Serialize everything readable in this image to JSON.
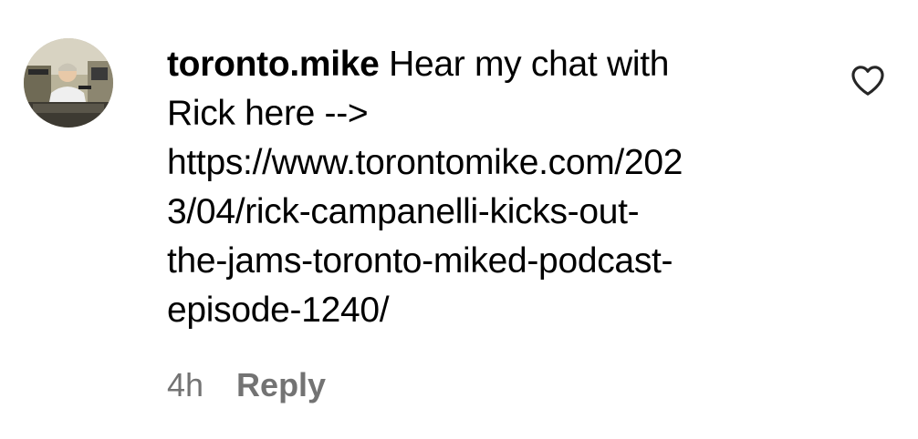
{
  "comment": {
    "username": "toronto.mike",
    "text_lines": [
      "Hear my chat with",
      "Rick here -->",
      "https://www.torontomike.com/202",
      "3/04/rick-campanelli-kicks-out-",
      "the-jams-toronto-miked-podcast-",
      "episode-1240/"
    ],
    "timestamp": "4h",
    "reply_label": "Reply",
    "like_icon": "heart-outline-icon",
    "avatar_icon": "profile-photo-avatar"
  },
  "colors": {
    "text": "#000000",
    "meta": "#737373",
    "background": "#ffffff"
  }
}
